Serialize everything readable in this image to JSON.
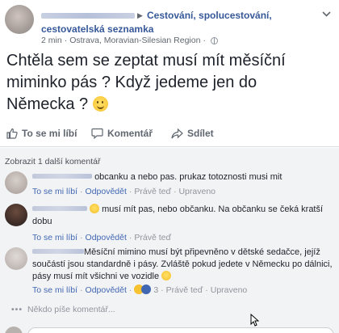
{
  "post": {
    "group_name_line1": "Cestování, spolucestování,",
    "group_name_line2": "cestovatelská seznamka",
    "time": "2 min",
    "location": "Ostrava, Moravian-Silesian Region",
    "separator": "·",
    "text": "Chtěla sem se zeptat musí mít měsíční miminko pás ? Když jedeme jen do Německa ?"
  },
  "actions": {
    "like": "To se mi líbí",
    "comment": "Komentář",
    "share": "Sdílet"
  },
  "comments_section": {
    "more_comments": "Zobrazit 1 další komentář",
    "typing": "Někdo píše komentář..."
  },
  "comments": [
    {
      "text": "obcanku a nebo pas. prukaz totoznosti musi mit",
      "like": "To se mi líbí",
      "reply": "Odpovědět",
      "time": "Právě teď",
      "edited": "Upraveno"
    },
    {
      "text": "musí mít pas, nebo občanku. Na občanku se čeká kratší dobu",
      "like": "To se mi líbí",
      "reply": "Odpovědět",
      "time": "Právě teď"
    },
    {
      "text": "Měsíční mimino musí být připevněno v dětské sedačce, jejíž součástí jsou standardně i pásy. Zvláště pokud jedete v Německu po dálnici, pásy musí mít všichni ve vozidle",
      "like": "To se mi líbí",
      "reply": "Odpovědět",
      "reaction_count": "3",
      "time": "Právě teď",
      "edited": "Upraveno"
    }
  ],
  "colors": {
    "link": "#365899",
    "action_link": "#4267b2",
    "meta": "#90949c",
    "comments_bg": "#f2f3f5"
  },
  "icons": [
    "caret-right-icon",
    "globe-icon",
    "chevron-down-icon",
    "thumbs-up-icon",
    "comment-icon",
    "share-icon",
    "smile-emoji-icon",
    "haha-reaction-icon",
    "like-reaction-icon",
    "cursor-icon"
  ]
}
